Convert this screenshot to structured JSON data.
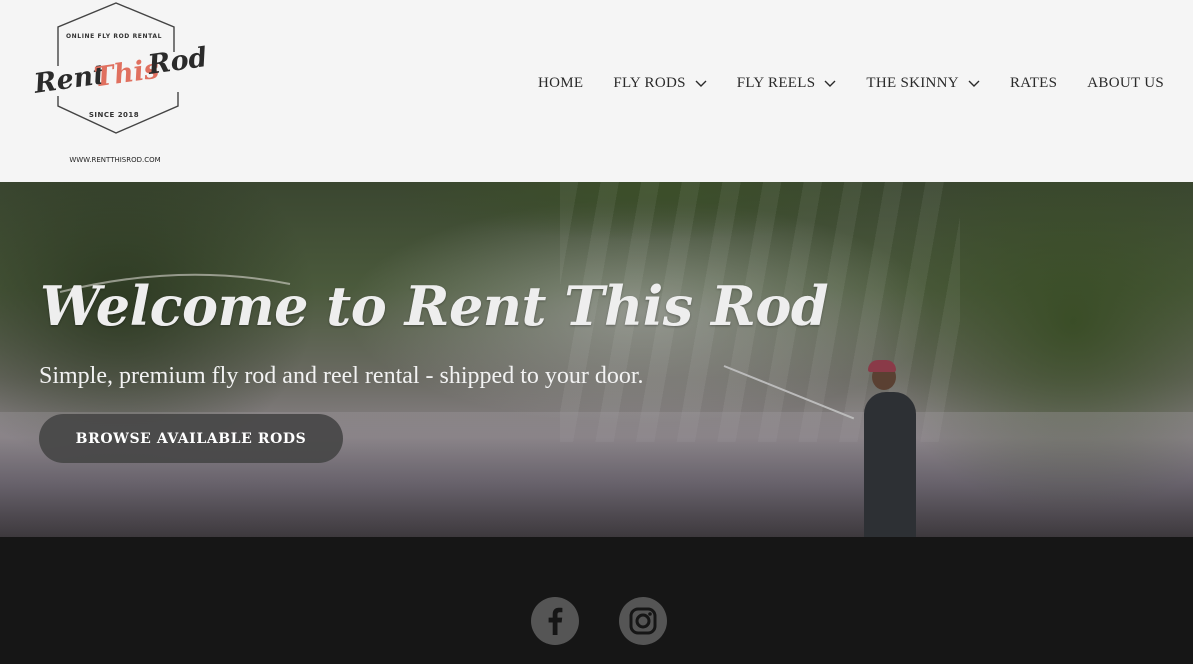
{
  "logo": {
    "top_text": "ONLINE FLY ROD RENTAL",
    "word1": "Rent",
    "word2": "This",
    "word3": "Rod",
    "since": "SINCE 2018",
    "url": "WWW.RENTTHISROD.COM",
    "accent_color": "#e0705f"
  },
  "nav": {
    "items": [
      {
        "label": "HOME",
        "dropdown": false
      },
      {
        "label": "FLY RODS",
        "dropdown": true
      },
      {
        "label": "FLY REELS",
        "dropdown": true
      },
      {
        "label": "THE SKINNY",
        "dropdown": true
      },
      {
        "label": "RATES",
        "dropdown": false
      },
      {
        "label": "ABOUT US",
        "dropdown": false
      }
    ]
  },
  "hero": {
    "title": "Welcome to Rent This Rod",
    "subtitle": "Simple, premium fly rod and reel rental - shipped to your door.",
    "cta_label": "BROWSE AVAILABLE RODS"
  },
  "footer": {
    "social": [
      {
        "icon": "facebook-icon"
      },
      {
        "icon": "instagram-icon"
      }
    ]
  }
}
